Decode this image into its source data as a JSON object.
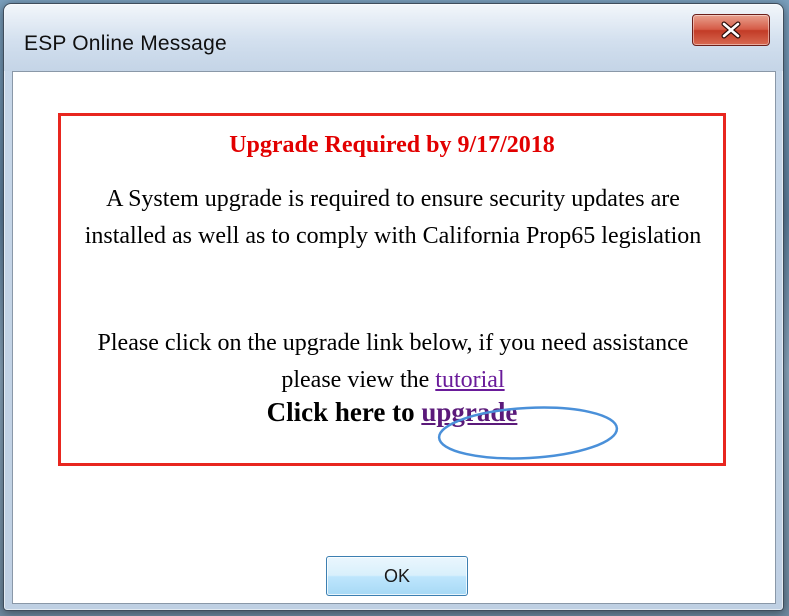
{
  "window": {
    "title": "ESP Online Message"
  },
  "message": {
    "heading": "Upgrade Required by 9/17/2018",
    "body": "A System upgrade is required to ensure security updates are installed as well as to comply with California Prop65 legislation",
    "assist_prefix": "Please click on the upgrade link below, if you need assistance please view the ",
    "tutorial_link": "tutorial",
    "cta_prefix": "Click here to ",
    "upgrade_link": "upgrade"
  },
  "buttons": {
    "ok_label": "OK"
  },
  "icons": {
    "close": "close-icon"
  },
  "colors": {
    "heading": "#e20000",
    "border": "#e8261f",
    "link": "#6a1b9a",
    "annotation": "#4a90d9"
  }
}
